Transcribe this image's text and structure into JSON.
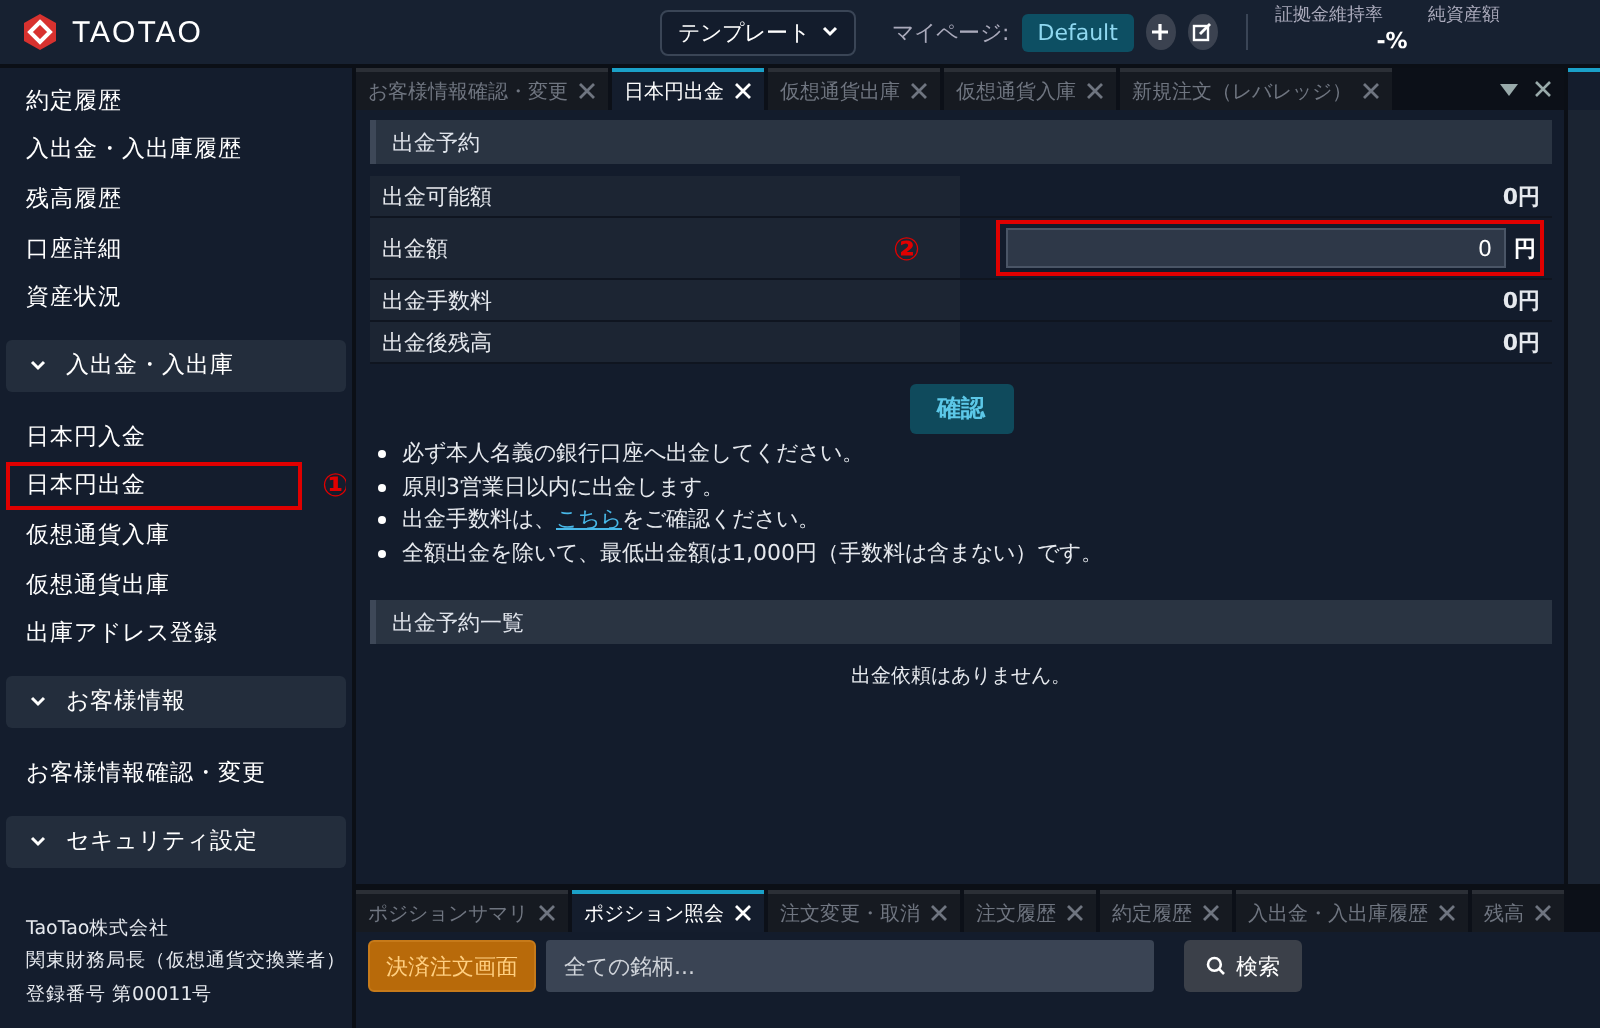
{
  "header": {
    "brand": "TAOTAO",
    "template_dropdown": "テンプレート",
    "mypage_label": "マイページ:",
    "mypage_button": "Default",
    "stats": [
      {
        "label": "証拠金維持率",
        "value": "-%"
      },
      {
        "label": "純資産額"
      }
    ]
  },
  "sidebar": {
    "items": [
      {
        "kind": "link",
        "label": "約定履歴",
        "selected": false
      },
      {
        "kind": "link",
        "label": "入出金・入出庫履歴",
        "selected": false
      },
      {
        "kind": "link",
        "label": "残高履歴",
        "selected": false
      },
      {
        "kind": "link",
        "label": "口座詳細",
        "selected": false
      },
      {
        "kind": "link",
        "label": "資産状況",
        "selected": false
      },
      {
        "kind": "section",
        "label": "入出金・入出庫",
        "expanded": true
      },
      {
        "kind": "link",
        "label": "日本円入金",
        "selected": false
      },
      {
        "kind": "link",
        "label": "日本円出金",
        "selected": true,
        "annotation": "①"
      },
      {
        "kind": "link",
        "label": "仮想通貨入庫",
        "selected": false
      },
      {
        "kind": "link",
        "label": "仮想通貨出庫",
        "selected": false
      },
      {
        "kind": "link",
        "label": "出庫アドレス登録",
        "selected": false
      },
      {
        "kind": "section",
        "label": "お客様情報",
        "expanded": true
      },
      {
        "kind": "link",
        "label": "お客様情報確認・変更",
        "selected": false
      },
      {
        "kind": "section",
        "label": "セキュリティ設定",
        "expanded": true
      }
    ],
    "footer": [
      "TaoTao株式会社",
      "関東財務局長（仮想通貨交換業者）",
      "登録番号 第00011号"
    ]
  },
  "main_tabs": [
    {
      "label": "お客様情報確認・変更",
      "selected": false
    },
    {
      "label": "日本円出金",
      "selected": true
    },
    {
      "label": "仮想通貨出庫",
      "selected": false
    },
    {
      "label": "仮想通貨入庫",
      "selected": false
    },
    {
      "label": "新規注文（レバレッジ）",
      "selected": false
    }
  ],
  "withdrawal": {
    "title": "出金予約",
    "rows": [
      {
        "kind": "value",
        "label": "出金可能額",
        "value": "0円"
      },
      {
        "kind": "input",
        "label": "出金額",
        "value": "0",
        "unit": "円",
        "annotation": "②"
      },
      {
        "kind": "value",
        "label": "出金手数料",
        "value": "0円"
      },
      {
        "kind": "value",
        "label": "出金後残高",
        "value": "0円"
      }
    ],
    "confirm_button": "確認",
    "notes": [
      "必ず本人名義の銀行口座へ出金してください。",
      "原則3営業日以内に出金します。",
      {
        "before": "出金手数料は、",
        "link": "こちら",
        "after": "をご確認ください。"
      },
      "全額出金を除いて、最低出金額は1,000円（手数料は含まない）です。"
    ],
    "list_title": "出金予約一覧",
    "empty_message": "出金依頼はありません。"
  },
  "bottom_tabs": [
    {
      "label": "ポジションサマリ",
      "selected": false
    },
    {
      "label": "ポジション照会",
      "selected": true
    },
    {
      "label": "注文変更・取消",
      "selected": false
    },
    {
      "label": "注文履歴",
      "selected": false
    },
    {
      "label": "約定履歴",
      "selected": false
    },
    {
      "label": "入出金・入出庫履歴",
      "selected": false
    },
    {
      "label": "残高",
      "selected": false
    }
  ],
  "bottom_toolbar": {
    "settle_button": "決済注文画面",
    "symbol_placeholder": "全ての銘柄...",
    "search_button": "検索"
  }
}
